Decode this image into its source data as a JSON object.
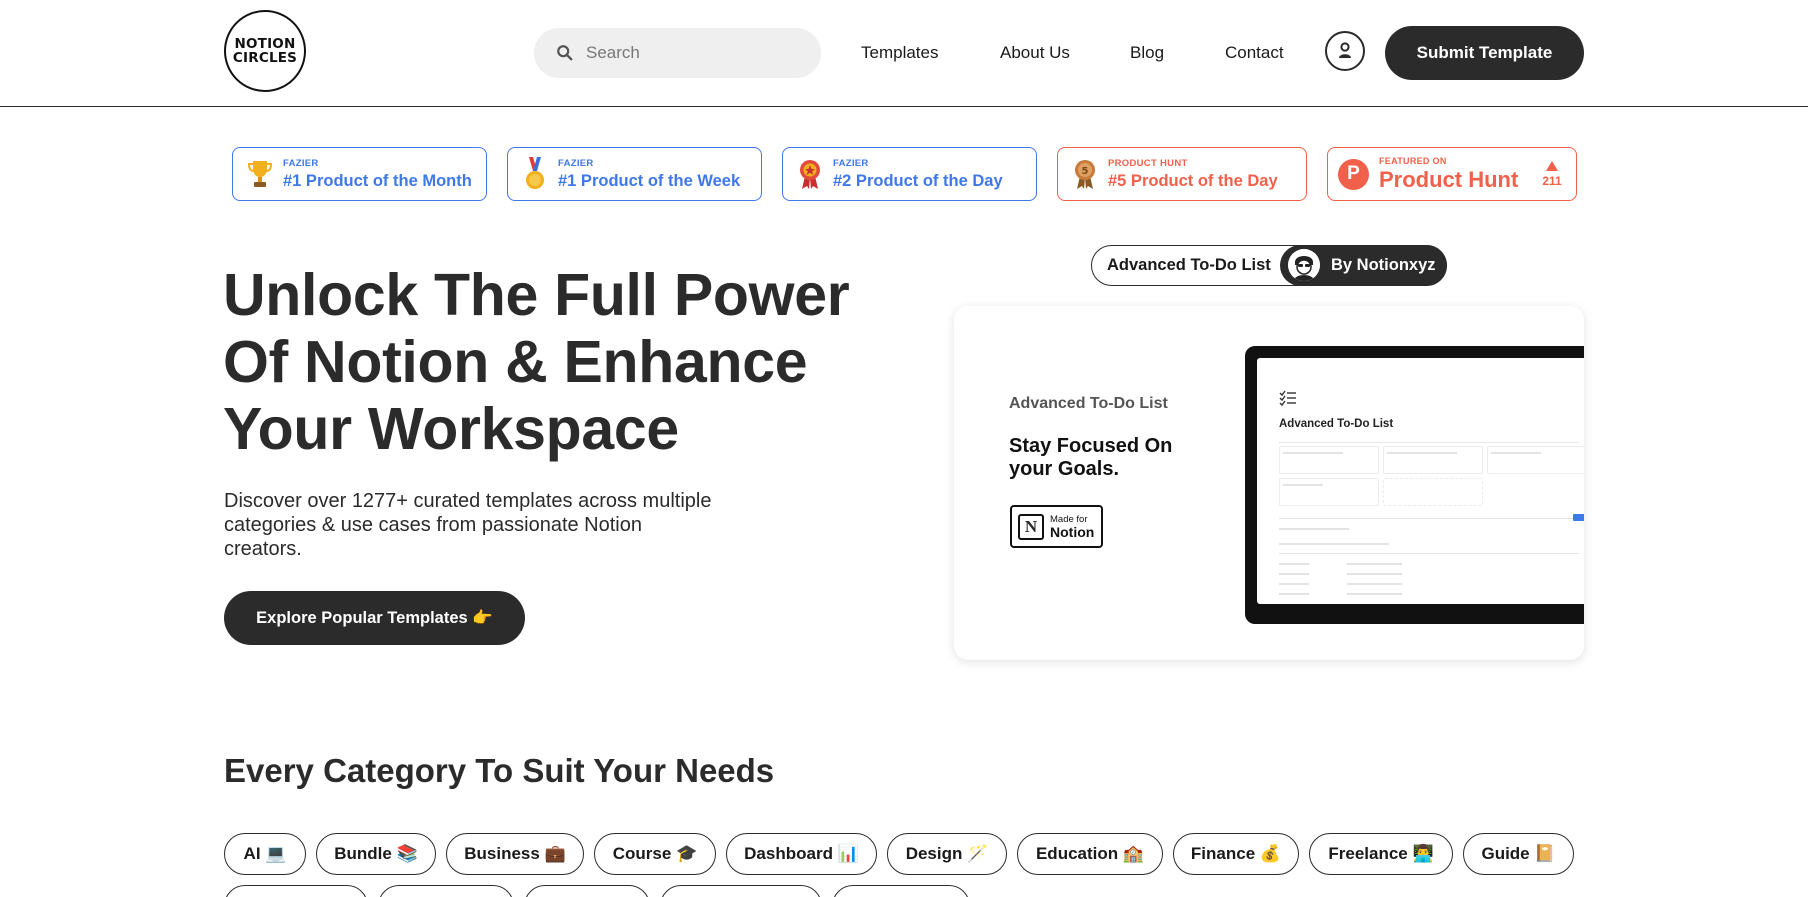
{
  "header": {
    "logo_text": "NOTION\nCIRCLES",
    "search_placeholder": "Search",
    "nav": [
      "Templates",
      "About Us",
      "Blog",
      "Contact"
    ],
    "submit_label": "Submit Template"
  },
  "badges": [
    {
      "source": "FAZIER",
      "label": "#1 Product of the Month",
      "icon": "trophy-icon",
      "color": "#3f78e8"
    },
    {
      "source": "FAZIER",
      "label": "#1 Product of the Week",
      "icon": "medal-icon",
      "color": "#3f78e8"
    },
    {
      "source": "FAZIER",
      "label": "#2 Product of the Day",
      "icon": "rosette-icon",
      "color": "#3f78e8"
    },
    {
      "source": "PRODUCT HUNT",
      "label": "#5 Product of the Day",
      "icon": "ph-medal-icon",
      "color": "#f0604a"
    }
  ],
  "producthunt": {
    "small": "FEATURED ON",
    "big": "Product Hunt",
    "votes": "211",
    "letter": "P"
  },
  "hero": {
    "title": "Unlock The Full Power Of Notion & Enhance Your Workspace",
    "subtitle": "Discover over 1277+ curated templates across multiple categories & use cases from passionate Notion creators.",
    "cta": "Explore Popular Templates 👉"
  },
  "featured": {
    "template_name": "Advanced To-Do List",
    "author": "By Notionxyz",
    "card_subtitle": "Advanced To-Do List",
    "card_title": "Stay Focused On your Goals.",
    "made_for_small": "Made for",
    "made_for_big": "Notion",
    "screen_title": "Advanced To-Do List"
  },
  "categories": {
    "title": "Every Category To Suit Your Needs",
    "items": [
      "AI 💻",
      "Bundle 📚",
      "Business 💼",
      "Course 🎓",
      "Dashboard 📊",
      "Design 🪄",
      "Education 🏫",
      "Finance 💰",
      "Freelance 👨‍💻",
      "Guide 📔"
    ]
  },
  "colors": {
    "dark": "#2b2b2b",
    "fazier_blue": "#3f78e8",
    "ph_red": "#f0604a"
  }
}
